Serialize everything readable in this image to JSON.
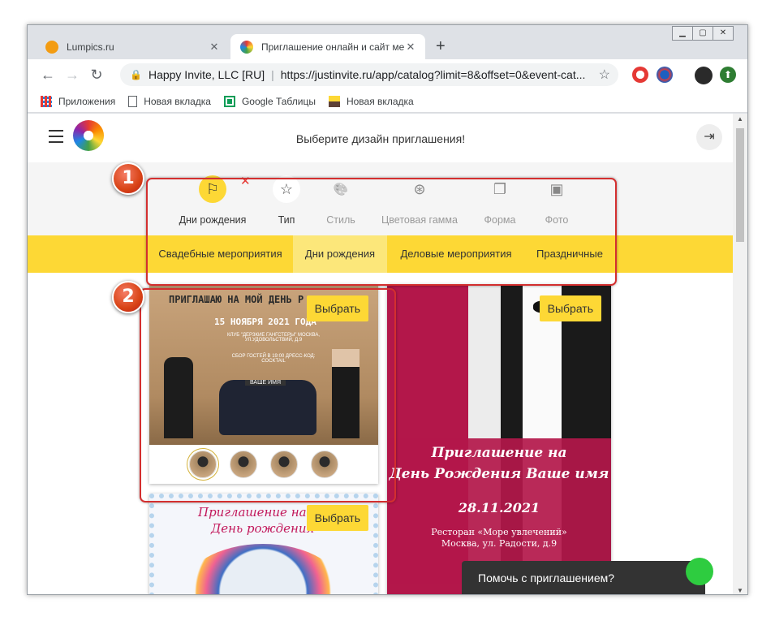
{
  "browser": {
    "tabs": [
      {
        "title": "Lumpics.ru",
        "close": "✕"
      },
      {
        "title": "Приглашение онлайн и сайт ме",
        "close": "✕"
      }
    ],
    "new_tab": "+",
    "nav": {
      "back": "←",
      "forward": "→",
      "reload": "↻"
    },
    "address": {
      "org": "Happy Invite, LLC [RU]",
      "sep": "|",
      "url": "https://justinvite.ru/app/catalog?limit=8&offset=0&event-cat..."
    },
    "bookmarks": [
      "Приложения",
      "Новая вкладка",
      "Google Таблицы",
      "Новая вкладка"
    ]
  },
  "header": {
    "title": "Выберите дизайн приглашения!"
  },
  "filters": [
    {
      "label": "Дни рождения",
      "icon": "flag-icon",
      "glyph": "⚐"
    },
    {
      "label": "Тип",
      "icon": "star-icon",
      "glyph": "☆"
    },
    {
      "label": "Стиль",
      "icon": "palette-icon",
      "glyph": "🎨"
    },
    {
      "label": "Цветовая гамма",
      "icon": "color-circles-icon",
      "glyph": "⊛"
    },
    {
      "label": "Форма",
      "icon": "shapes-icon",
      "glyph": "❐"
    },
    {
      "label": "Фото",
      "icon": "image-icon",
      "glyph": "▣"
    }
  ],
  "remove_filter": "✕",
  "categories": [
    "Свадебные мероприятия",
    "Дни рождения",
    "Деловые мероприятия",
    "Праздничные"
  ],
  "cards": {
    "choose_label": "Выбрать",
    "card1": {
      "line1": "ПРИГЛАШАЮ НА МОЙ ДЕНЬ Р",
      "date": "15 НОЯБРЯ 2021 ГОДА",
      "details": "КЛУБ \"ДЕРЗКИЕ ГАНГСТЕРЫ\" МОСКВА, УЛ.УДОВОЛЬСТВИЙ, Д.9",
      "details2": "СБОР ГОСТЕЙ В 19:00 ДРЕСС-КОД: COCKTAIL",
      "plate": "ВАШЕ ИМЯ"
    },
    "card2": {
      "title1": "Приглашение на",
      "title2": "День Рождения Ваше имя",
      "date": "28.11.2021",
      "place1": "Ресторан «Море увлечений»",
      "place2": "Москва, ул. Радости, д.9"
    },
    "card3": {
      "title1": "Приглашение на м",
      "title2": "День рождения"
    }
  },
  "annotations": {
    "badge1": "1",
    "badge2": "2"
  },
  "chat": {
    "label": "Помочь с приглашением?"
  },
  "colors": {
    "accent": "#fdd835",
    "annotation": "#d32f2f",
    "chat_bg": "#333333",
    "card2_bg": "#b3174a"
  }
}
